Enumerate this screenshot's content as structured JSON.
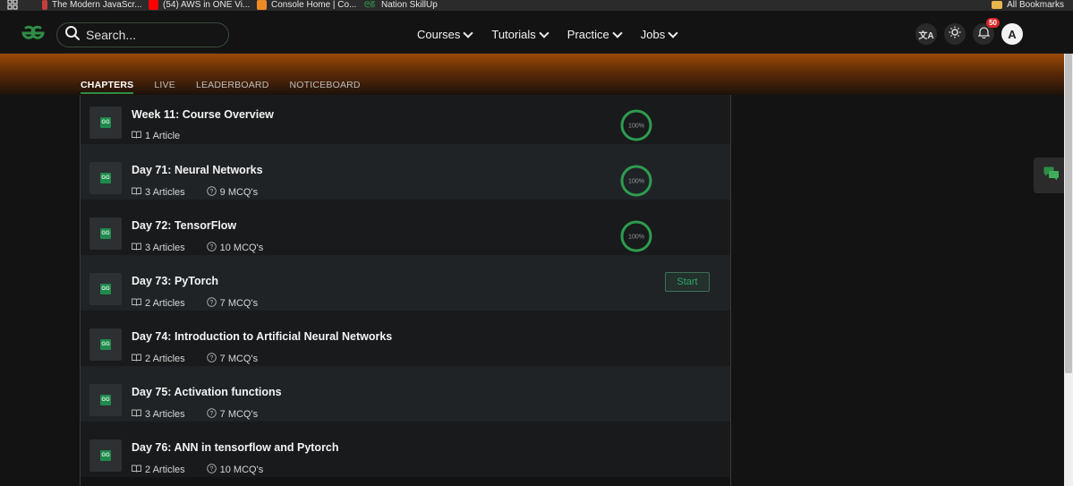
{
  "bookmarks": {
    "items": [
      {
        "label": "The Modern JavaScr...",
        "icon": "red-flag-icon",
        "color": "#c43d3d"
      },
      {
        "label": "(54) AWS in ONE Vi...",
        "icon": "youtube-icon",
        "color": "#ff0000"
      },
      {
        "label": "Console Home | Co...",
        "icon": "aws-icon",
        "color": "#f08a24"
      },
      {
        "label": "Nation SkillUp",
        "icon": "gfg-icon",
        "color": "#2f8d46"
      }
    ],
    "all_label": "All Bookmarks"
  },
  "nav": {
    "search_placeholder": "Search...",
    "menu": [
      "Courses",
      "Tutorials",
      "Practice",
      "Jobs"
    ],
    "notification_count": "50",
    "avatar_letter": "A"
  },
  "tabs": [
    {
      "label": "CHAPTERS",
      "active": true
    },
    {
      "label": "LIVE",
      "active": false
    },
    {
      "label": "LEADERBOARD",
      "active": false
    },
    {
      "label": "NOTICEBOARD",
      "active": false
    }
  ],
  "chapters": [
    {
      "title": "Week 11: Course Overview",
      "articles": "1 Article",
      "mcqs": "",
      "progress_label": "100%",
      "progress": 1.0,
      "status": "done"
    },
    {
      "title": "Day 71: Neural Networks",
      "articles": "3 Articles",
      "mcqs": "9 MCQ's",
      "progress_label": "100%",
      "progress": 1.0,
      "status": "done"
    },
    {
      "title": "Day 72: TensorFlow",
      "articles": "3 Articles",
      "mcqs": "10 MCQ's",
      "progress_label": "100%",
      "progress": 1.0,
      "status": "done"
    },
    {
      "title": "Day 73: PyTorch",
      "articles": "2 Articles",
      "mcqs": "7 MCQ's",
      "action": "Start",
      "status": "start"
    },
    {
      "title": "Day 74: Introduction to Artificial Neural Networks",
      "articles": "2 Articles",
      "mcqs": "7 MCQ's",
      "status": "none"
    },
    {
      "title": "Day 75: Activation functions",
      "articles": "3 Articles",
      "mcqs": "7 MCQ's",
      "status": "none"
    },
    {
      "title": "Day 76: ANN in tensorflow and Pytorch",
      "articles": "2 Articles",
      "mcqs": "10 MCQ's",
      "status": "none"
    }
  ],
  "colors": {
    "accent": "#2f8d46",
    "progress_ring": "#2e9c4f",
    "hero_top": "#9a4a08"
  }
}
